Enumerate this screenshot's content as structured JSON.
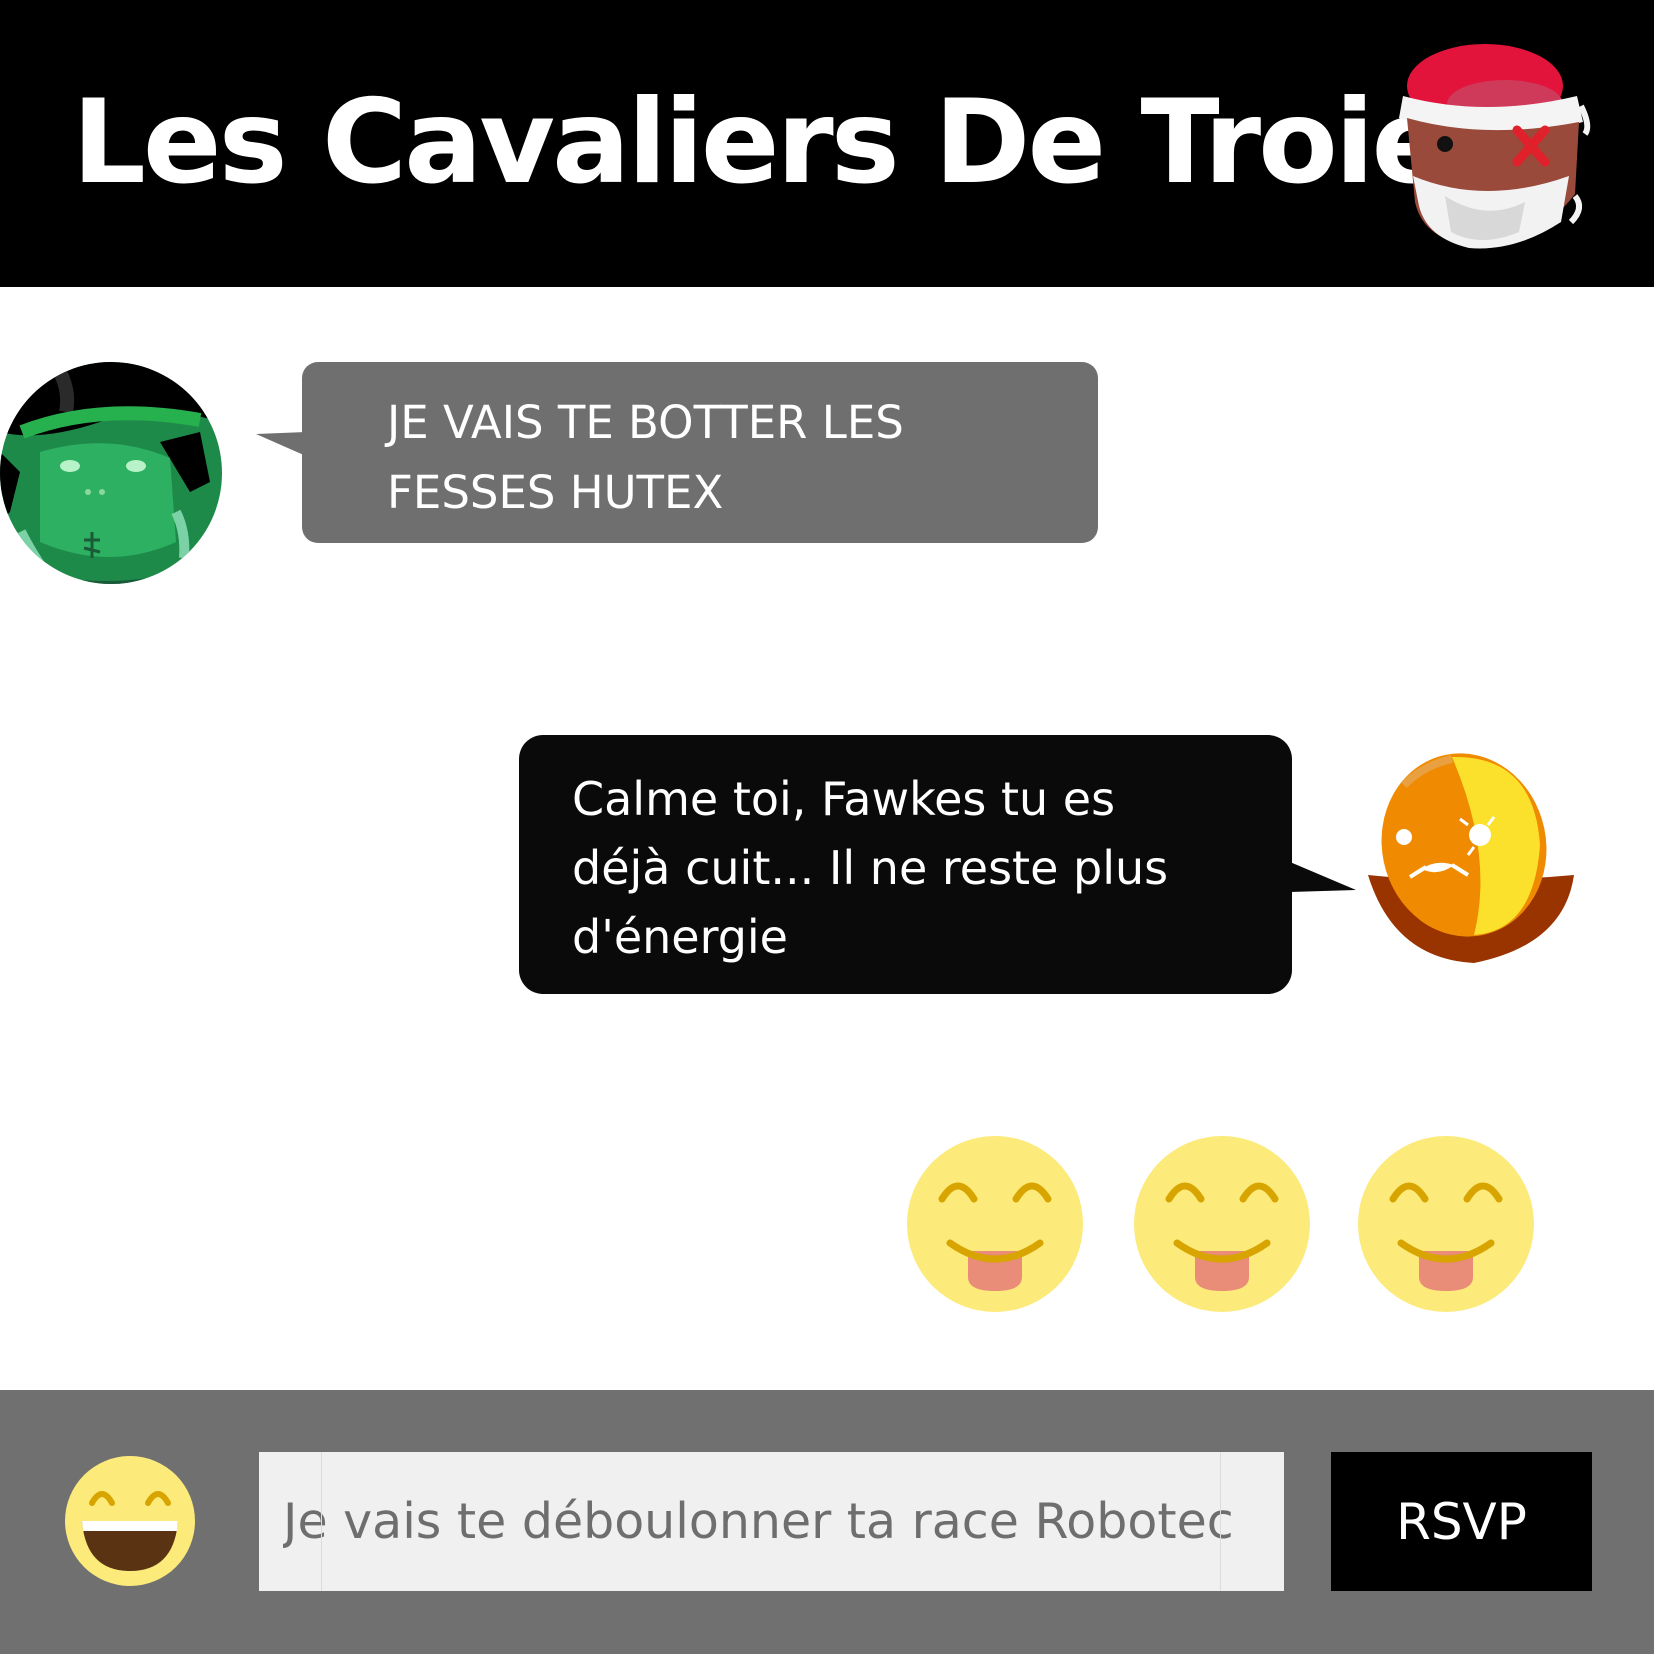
{
  "header": {
    "title": "Les Cavaliers De Troie"
  },
  "messages": [
    {
      "side": "left",
      "text_lines": [
        "JE VAIS TE BOTTER LES",
        "FESSES HUTEX"
      ],
      "bubble_color": "#6f6f6f"
    },
    {
      "side": "right",
      "text_lines": [
        "Calme toi, Fawkes tu es",
        "déjà cuit... Il ne reste plus",
        "d'énergie"
      ],
      "bubble_color": "#0a0a0a"
    }
  ],
  "reactions": [
    "tongue-emoji",
    "tongue-emoji",
    "tongue-emoji"
  ],
  "composer": {
    "emoji_icon": "grinning-emoji-icon",
    "input_value": "Je vais te déboulonner ta race Robotec",
    "send_label": "RSVP"
  },
  "colors": {
    "header_bg": "#000000",
    "footer_bg": "#707070",
    "input_bg": "#f0f0f0",
    "emoji_yellow": "#fcea7a",
    "emoji_feature": "#d8a400"
  }
}
